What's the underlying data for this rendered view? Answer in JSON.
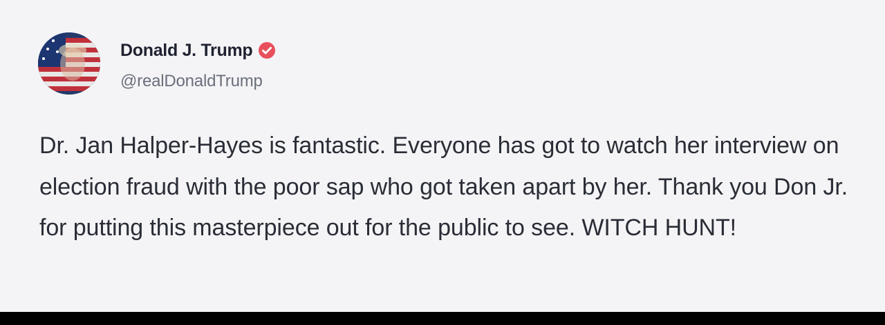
{
  "author": {
    "display_name": "Donald J. Trump",
    "handle": "@realDonaldTrump",
    "verified_icon": "verified-badge-icon",
    "avatar_icon": "avatar-flag-portrait"
  },
  "post": {
    "text": "Dr. Jan Halper-Hayes is fantastic. Everyone has got to watch her interview on election fraud with the poor sap who got taken apart by her. Thank you Don Jr. for putting this masterpiece out for the public to see. WITCH HUNT!"
  },
  "colors": {
    "background": "#f4f4f6",
    "name": "#1f2230",
    "handle": "#6b6f7c",
    "text": "#2a2d36",
    "verified": "#e8505b"
  }
}
